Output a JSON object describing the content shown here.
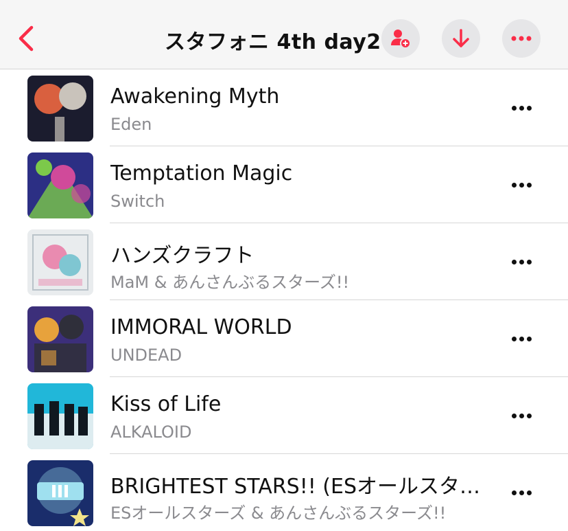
{
  "nav": {
    "title": "スタフォニ 4th day2",
    "back_icon": "chevron-left-icon",
    "actions": [
      {
        "name": "add-user-icon"
      },
      {
        "name": "download-icon"
      },
      {
        "name": "ellipsis-icon"
      }
    ]
  },
  "colors": {
    "accent": "#fa2d48",
    "nav_background": "#f6f6f6",
    "button_background": "#e6e6e8",
    "primary_text": "#111111",
    "secondary_text": "#8a8a8e"
  },
  "songs": [
    {
      "title": "Awakening Myth",
      "artist": "Eden",
      "art_colors": [
        "#1b1c2e",
        "#d9603f",
        "#c9c3bb"
      ]
    },
    {
      "title": "Temptation Magic",
      "artist": "Switch",
      "art_colors": [
        "#2c2f84",
        "#7cc94a",
        "#d04a9a"
      ]
    },
    {
      "title": "ハンズクラフト",
      "artist": "MaM & あんさんぶるスターズ!!",
      "art_colors": [
        "#e9ecee",
        "#e98bb0",
        "#7fc6d2"
      ]
    },
    {
      "title": "IMMORAL WORLD",
      "artist": "UNDEAD",
      "art_colors": [
        "#3c2f7a",
        "#e7a23c",
        "#2f2f3a"
      ]
    },
    {
      "title": "Kiss of Life",
      "artist": "ALKALOID",
      "art_colors": [
        "#21b7d9",
        "#101820",
        "#f2f2f2"
      ]
    },
    {
      "title": "BRIGHTEST STARS!! (ESオールスターズ ver.)",
      "artist": "ESオールスターズ & あんさんぶるスターズ!!",
      "art_colors": [
        "#1a2d6b",
        "#9fe0ef",
        "#f2e38a"
      ]
    }
  ]
}
